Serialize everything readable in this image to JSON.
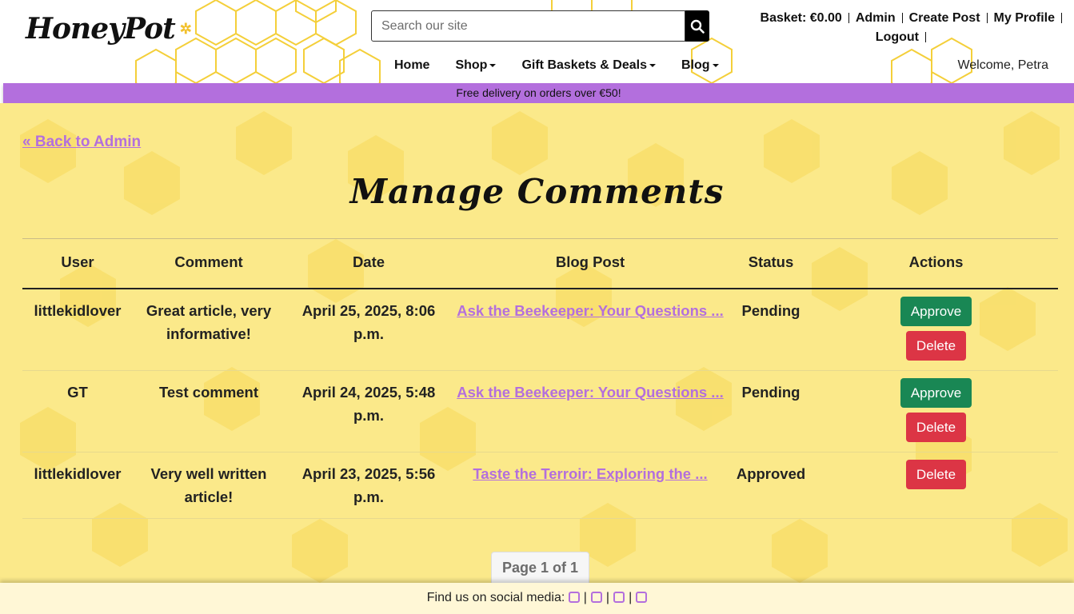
{
  "header": {
    "logo_text": "HoneyPot",
    "search_placeholder": "Search our site",
    "top_links": [
      "Basket: €0.00",
      "Admin",
      "Create Post",
      "My Profile",
      "Logout"
    ],
    "nav": [
      {
        "label": "Home",
        "dropdown": false
      },
      {
        "label": "Shop",
        "dropdown": true
      },
      {
        "label": "Gift Baskets & Deals",
        "dropdown": true
      },
      {
        "label": "Blog",
        "dropdown": true
      }
    ],
    "welcome": "Welcome, Petra"
  },
  "promo": "Free delivery on orders over €50!",
  "main": {
    "back_link": "« Back to Admin",
    "title": "Manage Comments",
    "columns": [
      "User",
      "Comment",
      "Date",
      "Blog Post",
      "Status",
      "Actions"
    ],
    "rows": [
      {
        "user": "littlekidlover",
        "comment": "Great article, very informative!",
        "date": "April 25, 2025, 8:06 p.m.",
        "post": "Ask the Beekeeper: Your Questions ...",
        "status": "Pending",
        "actions": [
          "Approve",
          "Delete"
        ]
      },
      {
        "user": "GT",
        "comment": "Test comment",
        "date": "April 24, 2025, 5:48 p.m.",
        "post": "Ask the Beekeeper: Your Questions ...",
        "status": "Pending",
        "actions": [
          "Approve",
          "Delete"
        ]
      },
      {
        "user": "littlekidlover",
        "comment": "Very well written article!",
        "date": "April 23, 2025, 5:56 p.m.",
        "post": "Taste the Terroir: Exploring the ...",
        "status": "Approved",
        "actions": [
          "Delete"
        ]
      }
    ],
    "pager": "Page 1 of 1"
  },
  "footer": {
    "text": "Find us on social media:",
    "icons": [
      "github-icon",
      "facebook-icon",
      "youtube-icon",
      "instagram-icon"
    ]
  },
  "colors": {
    "accent": "#b36fdd",
    "approve": "#198754",
    "delete": "#dc3545",
    "honey": "#fbe98a"
  }
}
